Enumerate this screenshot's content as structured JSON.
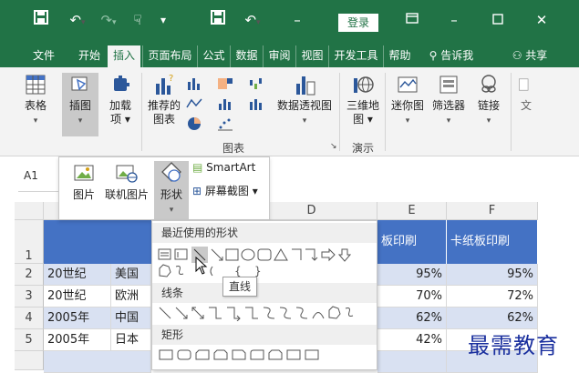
{
  "titlebar": {
    "login": "登录"
  },
  "menu": {
    "tabs": [
      "文件",
      "开始",
      "插入",
      "页面布局",
      "公式",
      "数据",
      "审阅",
      "视图",
      "开发工具",
      "帮助"
    ],
    "tell_me": "告诉我",
    "share": "共享"
  },
  "ribbon": {
    "table": "表格",
    "illustrations": "插图",
    "addins": [
      "加载",
      "项 ▾"
    ],
    "recommended_charts": [
      "推荐的",
      "图表"
    ],
    "pivot_chart": "数据透视图",
    "map3d": [
      "三维地",
      "图 ▾"
    ],
    "sparklines": "迷你图",
    "filters": "筛选器",
    "links": "链接",
    "more": "文",
    "group_charts": "图表",
    "group_tours": "演示"
  },
  "namebox": "A1",
  "illustrations_dropdown": {
    "pictures": "图片",
    "online_pictures": "联机图片",
    "shapes": "形状",
    "smartart": "SmartArt",
    "screenshot": "屏幕截图 ▾"
  },
  "sheet": {
    "column_headers": [
      "D",
      "E",
      "F"
    ],
    "row_numbers": [
      "1",
      "2",
      "3",
      "4",
      "5"
    ],
    "header_row": [
      "板印刷",
      "卡纸板印刷"
    ],
    "rows": [
      {
        "a": "20世纪",
        "b": "美国",
        "e": "95%",
        "f": "95%"
      },
      {
        "a": "20世纪",
        "b": "欧洲",
        "e": "70%",
        "f": "72%"
      },
      {
        "a": "2005年",
        "b": "中国",
        "e": "62%",
        "f": "62%"
      },
      {
        "a": "2005年",
        "b": "日本",
        "e": "42%",
        "f": ""
      }
    ]
  },
  "shapes_gallery": {
    "recent": "最近使用的形状",
    "lines": "线条",
    "rectangles": "矩形",
    "tooltip": "直线"
  },
  "watermark": "最需教育",
  "colors": {
    "excel_green": "#217346",
    "header_blue": "#4472c4",
    "watermark": "#1a2f9e"
  }
}
